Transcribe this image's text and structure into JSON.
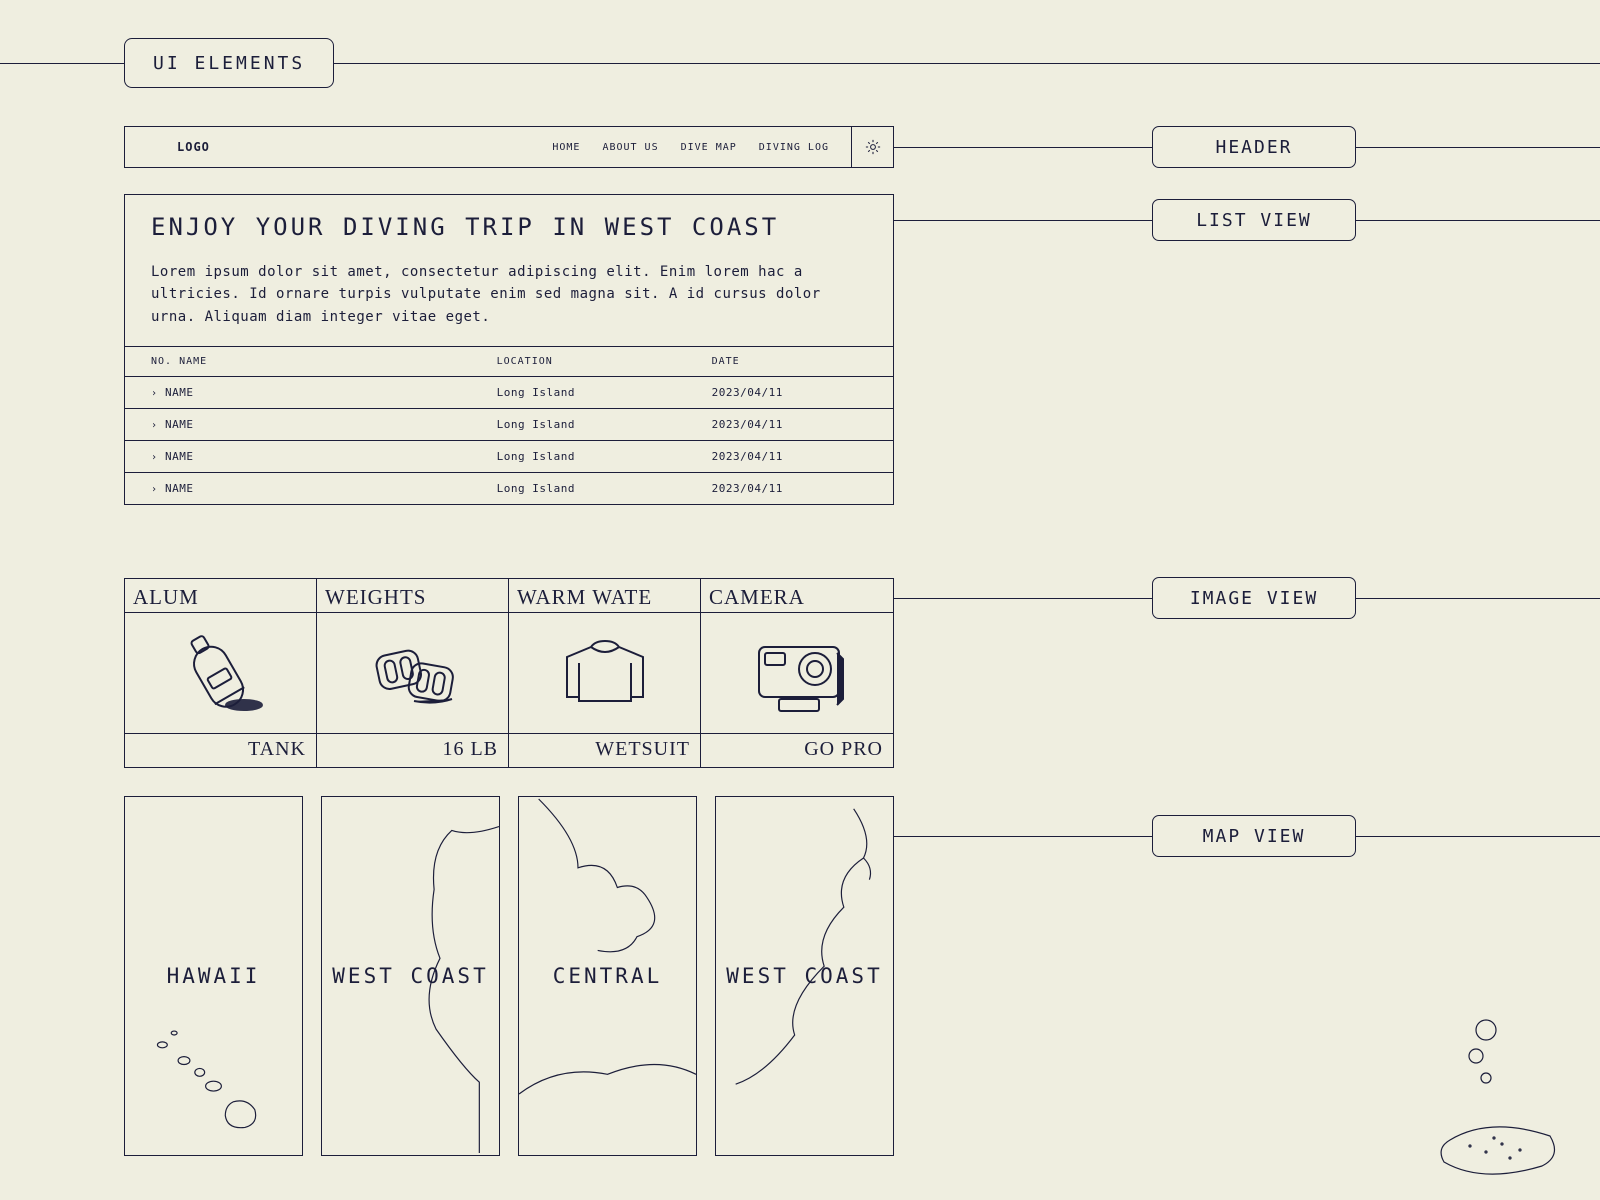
{
  "page_title": "UI ELEMENTS",
  "section_labels": {
    "header": "HEADER",
    "list_view": "LIST VIEW",
    "image_view": "IMAGE VIEW",
    "map_view": "MAP VIEW"
  },
  "header": {
    "logo_text": "LOGO",
    "nav": [
      "HOME",
      "ABOUT US",
      "DIVE MAP",
      "DIVING LOG"
    ]
  },
  "list_view": {
    "title": "ENJOY YOUR DIVING TRIP IN WEST COAST",
    "body": "Lorem ipsum dolor sit amet, consectetur adipiscing elit. Enim lorem hac a ultricies. Id ornare turpis vulputate enim sed magna sit. A id cursus dolor urna. Aliquam diam integer vitae eget.",
    "columns": {
      "no_name": "NO. NAME",
      "location": "LOCATION",
      "date": "DATE"
    },
    "rows": [
      {
        "name": "NAME",
        "location": "Long Island",
        "date": "2023/04/11"
      },
      {
        "name": "NAME",
        "location": "Long Island",
        "date": "2023/04/11"
      },
      {
        "name": "NAME",
        "location": "Long Island",
        "date": "2023/04/11"
      },
      {
        "name": "NAME",
        "location": "Long Island",
        "date": "2023/04/11"
      }
    ]
  },
  "image_view": {
    "items": [
      {
        "top": "ALUM",
        "bottom": "TANK",
        "icon": "scuba-tank-icon"
      },
      {
        "top": "WEIGHTS",
        "bottom": "16 LB",
        "icon": "weights-icon"
      },
      {
        "top": "WARM WATE",
        "bottom": "WETSUIT",
        "icon": "wetsuit-icon"
      },
      {
        "top": "CAMERA",
        "bottom": "GO PRO",
        "icon": "camera-icon"
      }
    ]
  },
  "map_view": {
    "items": [
      {
        "label": "HAWAII"
      },
      {
        "label": "WEST COAST"
      },
      {
        "label": "CENTRAL"
      },
      {
        "label": "WEST COAST"
      }
    ]
  }
}
